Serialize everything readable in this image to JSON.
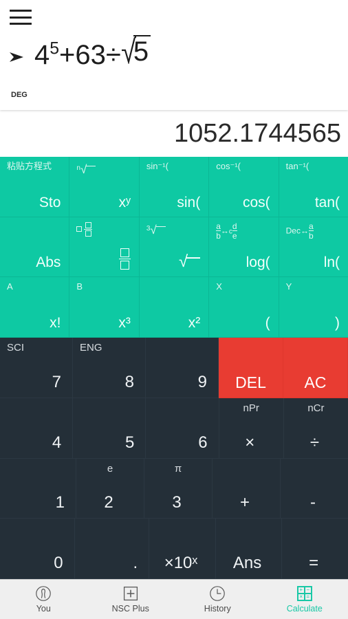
{
  "display": {
    "menu_icon": "hamburger-menu-icon",
    "cursor_icon": "cursor-arrow-icon",
    "expression_parts": {
      "base": "4",
      "exponent": "5",
      "middle": "+63÷",
      "radicand": "5"
    },
    "expression_plain": "4^5+63÷√5",
    "angle_mode": "DEG",
    "result": "1052.1744565"
  },
  "keypad": {
    "rows": [
      {
        "style": "teal",
        "keys": [
          {
            "sec": "粘贴方程式",
            "main": "Sto",
            "name": "sto"
          },
          {
            "sec": "nth-root-icon",
            "main": "xʸ",
            "name": "x-power-y"
          },
          {
            "sec": "sin⁻¹(",
            "main": "sin(",
            "name": "sin"
          },
          {
            "sec": "cos⁻¹(",
            "main": "cos(",
            "name": "cos"
          },
          {
            "sec": "tan⁻¹(",
            "main": "tan(",
            "name": "tan"
          }
        ]
      },
      {
        "style": "teal",
        "keys": [
          {
            "sec": "",
            "main": "Abs",
            "name": "abs"
          },
          {
            "sec": "mixed-fraction-icon",
            "main": "fraction-icon",
            "name": "fraction"
          },
          {
            "sec": "cube-root-icon",
            "main": "square-root-icon",
            "name": "square-root"
          },
          {
            "sec": "a/b↔c d/e",
            "main": "log(",
            "name": "log"
          },
          {
            "sec": "Dec↔a/b",
            "main": "ln(",
            "name": "ln"
          }
        ]
      },
      {
        "style": "teal",
        "keys": [
          {
            "sec": "A",
            "main": "x!",
            "name": "factorial"
          },
          {
            "sec": "B",
            "main": "x³",
            "name": "x-cubed"
          },
          {
            "sec": "",
            "main": "x²",
            "name": "x-squared"
          },
          {
            "sec": "X",
            "main": "(",
            "name": "open-paren"
          },
          {
            "sec": "Y",
            "main": ")",
            "name": "close-paren"
          }
        ]
      },
      {
        "style": "dark",
        "keys": [
          {
            "sec": "SCI",
            "main": "7",
            "name": "seven"
          },
          {
            "sec": "ENG",
            "main": "8",
            "name": "eight"
          },
          {
            "sec": "",
            "main": "9",
            "name": "nine"
          },
          {
            "sec": "",
            "main": "DEL",
            "name": "delete",
            "style": "red"
          },
          {
            "sec": "",
            "main": "AC",
            "name": "all-clear",
            "style": "red"
          }
        ]
      },
      {
        "style": "dark",
        "keys": [
          {
            "sec": "",
            "main": "4",
            "name": "four"
          },
          {
            "sec": "",
            "main": "5",
            "name": "five"
          },
          {
            "sec": "",
            "main": "6",
            "name": "six"
          },
          {
            "sec": "nPr",
            "main": "×",
            "name": "multiply",
            "center": true
          },
          {
            "sec": "nCr",
            "main": "÷",
            "name": "divide",
            "center": true
          }
        ]
      },
      {
        "style": "dark",
        "keys": [
          {
            "sec": "",
            "main": "1",
            "name": "one"
          },
          {
            "sec": "e",
            "main": "2",
            "name": "two",
            "center": true
          },
          {
            "sec": "π",
            "main": "3",
            "name": "three",
            "center": true
          },
          {
            "sec": "",
            "main": "+",
            "name": "plus",
            "center": true
          },
          {
            "sec": "",
            "main": "-",
            "name": "minus",
            "center": true
          }
        ]
      },
      {
        "style": "dark",
        "keys": [
          {
            "sec": "",
            "main": "0",
            "name": "zero"
          },
          {
            "sec": "",
            "main": ".",
            "name": "decimal-point"
          },
          {
            "sec": "",
            "main": "×10ˣ",
            "name": "times-ten-power",
            "center": true
          },
          {
            "sec": "",
            "main": "Ans",
            "name": "answer",
            "center": true
          },
          {
            "sec": "",
            "main": "=",
            "name": "equals",
            "center": true
          }
        ]
      }
    ]
  },
  "bottom_nav": {
    "items": [
      {
        "label": "You",
        "icon": "person-circle-icon",
        "active": false
      },
      {
        "label": "NSC Plus",
        "icon": "plus-square-icon",
        "active": false
      },
      {
        "label": "History",
        "icon": "clock-icon",
        "active": false
      },
      {
        "label": "Calculate",
        "icon": "calculator-grid-icon",
        "active": true
      }
    ]
  },
  "colors": {
    "teal": "#0ec9a3",
    "dark": "#242f38",
    "red": "#e83c32",
    "accent": "#19c8a6",
    "nav_bg": "#efefef"
  }
}
